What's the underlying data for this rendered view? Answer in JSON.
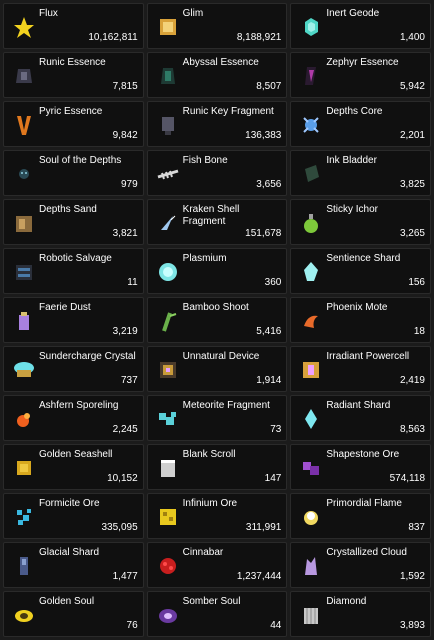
{
  "items": [
    {
      "name": "Flux",
      "count": "10,162,811",
      "icon": "flux-icon",
      "color": "#f2d21f"
    },
    {
      "name": "Glim",
      "count": "8,188,921",
      "icon": "glim-cube-icon",
      "color": "#d9a23a"
    },
    {
      "name": "Inert Geode",
      "count": "1,400",
      "icon": "geode-icon",
      "color": "#4fd6c6"
    },
    {
      "name": "Runic Essence",
      "count": "7,815",
      "icon": "runic-essence-icon",
      "color": "#3a3a4a"
    },
    {
      "name": "Abyssal Essence",
      "count": "8,507",
      "icon": "abyssal-essence-icon",
      "color": "#2e7a66"
    },
    {
      "name": "Zephyr Essence",
      "count": "5,942",
      "icon": "zephyr-essence-icon",
      "color": "#b03aa8"
    },
    {
      "name": "Pyric Essence",
      "count": "9,842",
      "icon": "pyric-essence-icon",
      "color": "#e0781e"
    },
    {
      "name": "Runic Key Fragment",
      "count": "136,383",
      "icon": "runic-key-fragment-icon",
      "color": "#555566"
    },
    {
      "name": "Depths Core",
      "count": "2,201",
      "icon": "depths-core-icon",
      "color": "#5a9ee8"
    },
    {
      "name": "Soul of the Depths",
      "count": "979",
      "icon": "soul-of-depths-icon",
      "color": "#2a4a55"
    },
    {
      "name": "Fish Bone",
      "count": "3,656",
      "icon": "fish-bone-icon",
      "color": "#d8d8d8"
    },
    {
      "name": "Ink Bladder",
      "count": "3,825",
      "icon": "ink-bladder-icon",
      "color": "#2f4a3c"
    },
    {
      "name": "Depths Sand",
      "count": "3,821",
      "icon": "depths-sand-icon",
      "color": "#8a6a3c"
    },
    {
      "name": "Kraken Shell Fragment",
      "count": "151,678",
      "icon": "kraken-shell-icon",
      "color": "#9fc8f0"
    },
    {
      "name": "Sticky Ichor",
      "count": "3,265",
      "icon": "sticky-ichor-icon",
      "color": "#7dc83a"
    },
    {
      "name": "Robotic Salvage",
      "count": "11",
      "icon": "robotic-salvage-icon",
      "color": "#4a7aa8"
    },
    {
      "name": "Plasmium",
      "count": "360",
      "icon": "plasmium-icon",
      "color": "#7ee6e6"
    },
    {
      "name": "Sentience Shard",
      "count": "156",
      "icon": "sentience-shard-icon",
      "color": "#9ff0f0"
    },
    {
      "name": "Faerie Dust",
      "count": "3,219",
      "icon": "faerie-dust-icon",
      "color": "#a880e0"
    },
    {
      "name": "Bamboo Shoot",
      "count": "5,416",
      "icon": "bamboo-shoot-icon",
      "color": "#6ab04a"
    },
    {
      "name": "Phoenix Mote",
      "count": "18",
      "icon": "phoenix-mote-icon",
      "color": "#e86a2a"
    },
    {
      "name": "Sundercharge Crystal",
      "count": "737",
      "icon": "sundercharge-crystal-icon",
      "color": "#6ee0e8"
    },
    {
      "name": "Unnatural Device",
      "count": "1,914",
      "icon": "unnatural-device-icon",
      "color": "#c89a3a"
    },
    {
      "name": "Irradiant Powercell",
      "count": "2,419",
      "icon": "irradiant-powercell-icon",
      "color": "#d8a03c"
    },
    {
      "name": "Ashfern Sporeling",
      "count": "2,245",
      "icon": "ashfern-sporeling-icon",
      "color": "#f0601e"
    },
    {
      "name": "Meteorite Fragment",
      "count": "73",
      "icon": "meteorite-fragment-icon",
      "color": "#5ad0d8"
    },
    {
      "name": "Radiant Shard",
      "count": "8,563",
      "icon": "radiant-shard-icon",
      "color": "#7ee8f0"
    },
    {
      "name": "Golden Seashell",
      "count": "10,152",
      "icon": "golden-seashell-icon",
      "color": "#d8a81e"
    },
    {
      "name": "Blank Scroll",
      "count": "147",
      "icon": "blank-scroll-icon",
      "color": "#cfcfcf"
    },
    {
      "name": "Shapestone Ore",
      "count": "574,118",
      "icon": "shapestone-ore-icon",
      "color": "#a050d0"
    },
    {
      "name": "Formicite Ore",
      "count": "335,095",
      "icon": "formicite-ore-icon",
      "color": "#3ab8e0"
    },
    {
      "name": "Infinium Ore",
      "count": "311,991",
      "icon": "infinium-ore-icon",
      "color": "#e8c81e"
    },
    {
      "name": "Primordial Flame",
      "count": "837",
      "icon": "primordial-flame-icon",
      "color": "#f0d860"
    },
    {
      "name": "Glacial Shard",
      "count": "1,477",
      "icon": "glacial-shard-icon",
      "color": "#4a5a8a"
    },
    {
      "name": "Cinnabar",
      "count": "1,237,444",
      "icon": "cinnabar-icon",
      "color": "#c81e1e"
    },
    {
      "name": "Crystallized Cloud",
      "count": "1,592",
      "icon": "crystallized-cloud-icon",
      "color": "#b898e0"
    },
    {
      "name": "Golden Soul",
      "count": "76",
      "icon": "golden-soul-icon",
      "color": "#f0d020"
    },
    {
      "name": "Somber Soul",
      "count": "44",
      "icon": "somber-soul-icon",
      "color": "#6a3aa0"
    },
    {
      "name": "Diamond",
      "count": "3,893",
      "icon": "diamond-icon",
      "color": "#c8c8c8"
    }
  ]
}
